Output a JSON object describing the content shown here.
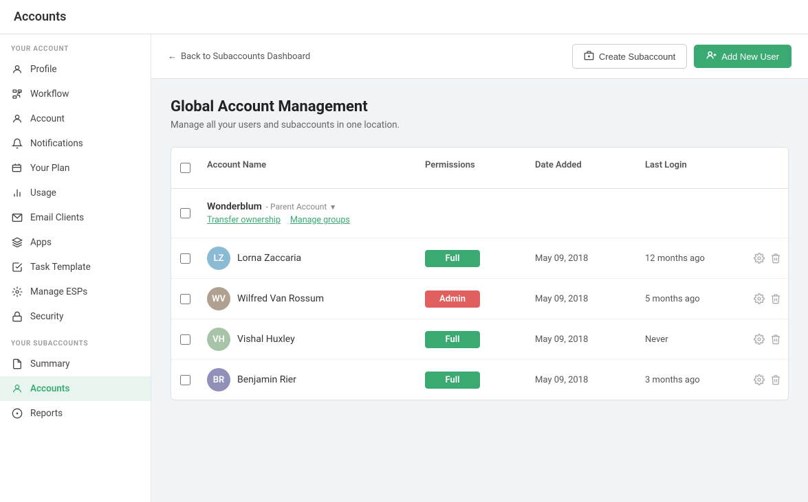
{
  "topbar": {
    "title": "Accounts"
  },
  "subheader": {
    "back_label": "Back to Subaccounts Dashboard",
    "create_subaccount_label": "Create Subaccount",
    "add_new_user_label": "Add New User"
  },
  "sidebar": {
    "your_account_label": "YOUR ACCOUNT",
    "your_subaccounts_label": "YOUR SUBACCOUNTS",
    "items": [
      {
        "id": "profile",
        "label": "Profile",
        "icon": "user"
      },
      {
        "id": "workflow",
        "label": "Workflow",
        "icon": "workflow"
      },
      {
        "id": "account",
        "label": "Account",
        "icon": "account"
      },
      {
        "id": "notifications",
        "label": "Notifications",
        "icon": "bell"
      },
      {
        "id": "your-plan",
        "label": "Your Plan",
        "icon": "tag"
      },
      {
        "id": "usage",
        "label": "Usage",
        "icon": "bar-chart"
      },
      {
        "id": "email-clients",
        "label": "Email Clients",
        "icon": "email"
      },
      {
        "id": "apps",
        "label": "Apps",
        "icon": "layers"
      },
      {
        "id": "task-template",
        "label": "Task Template",
        "icon": "check-square"
      },
      {
        "id": "manage-esps",
        "label": "Manage ESPs",
        "icon": "manage"
      },
      {
        "id": "security",
        "label": "Security",
        "icon": "lock"
      }
    ],
    "subaccount_items": [
      {
        "id": "summary",
        "label": "Summary",
        "icon": "file"
      },
      {
        "id": "accounts",
        "label": "Accounts",
        "icon": "user",
        "active": true
      },
      {
        "id": "reports",
        "label": "Reports",
        "icon": "reports"
      }
    ]
  },
  "content": {
    "title": "Global Account Management",
    "subtitle": "Manage all your users and subaccounts in one location.",
    "table": {
      "headers": [
        "",
        "Account Name",
        "Permissions",
        "Date Added",
        "Last Login",
        ""
      ],
      "parent_account": {
        "name": "Wonderblum",
        "tag": "- Parent Account",
        "links": [
          "Transfer ownership",
          "Manage groups"
        ]
      },
      "rows": [
        {
          "name": "Lorna Zaccaria",
          "permission": "Full",
          "permission_type": "full",
          "date_added": "May 09, 2018",
          "last_login": "12 months ago",
          "avatar_color": "#8bbad4",
          "initials": "LZ"
        },
        {
          "name": "Wilfred Van Rossum",
          "permission": "Admin",
          "permission_type": "admin",
          "date_added": "May 09, 2018",
          "last_login": "5 months ago",
          "avatar_color": "#b0a090",
          "initials": "WV"
        },
        {
          "name": "Vishal Huxley",
          "permission": "Full",
          "permission_type": "full",
          "date_added": "May 09, 2018",
          "last_login": "Never",
          "avatar_color": "#a8c4a8",
          "initials": "VH"
        },
        {
          "name": "Benjamin Rier",
          "permission": "Full",
          "permission_type": "full",
          "date_added": "May 09, 2018",
          "last_login": "3 months ago",
          "avatar_color": "#9090b8",
          "initials": "BR"
        }
      ]
    }
  }
}
